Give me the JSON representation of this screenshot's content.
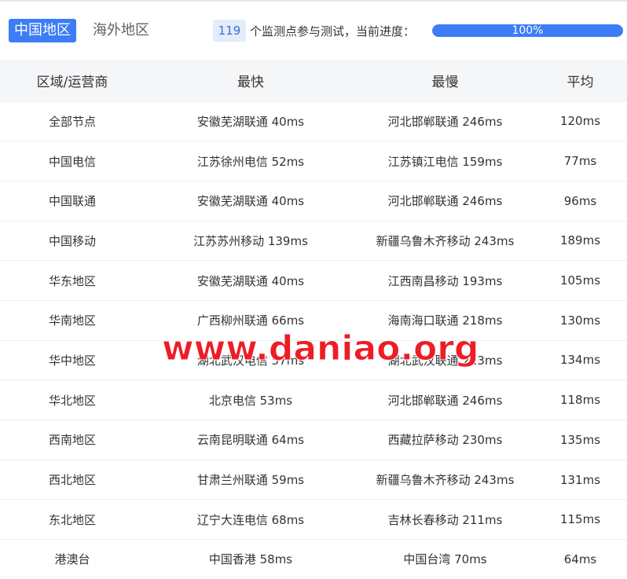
{
  "region_tabs": {
    "domestic": "中国地区",
    "overseas": "海外地区"
  },
  "progress": {
    "node_count": "119",
    "text": "个监测点参与测试，当前进度：",
    "percent_label": "100%",
    "percent": 100
  },
  "table": {
    "headers": [
      "区域/运营商",
      "最快",
      "最慢",
      "平均"
    ],
    "rows": [
      [
        "全部节点",
        "安徽芜湖联通 40ms",
        "河北邯郸联通 246ms",
        "120ms"
      ],
      [
        "中国电信",
        "江苏徐州电信 52ms",
        "江苏镇江电信 159ms",
        "77ms"
      ],
      [
        "中国联通",
        "安徽芜湖联通 40ms",
        "河北邯郸联通 246ms",
        "96ms"
      ],
      [
        "中国移动",
        "江苏苏州移动 139ms",
        "新疆乌鲁木齐移动 243ms",
        "189ms"
      ],
      [
        "华东地区",
        "安徽芜湖联通 40ms",
        "江西南昌移动 193ms",
        "105ms"
      ],
      [
        "华南地区",
        "广西柳州联通 66ms",
        "海南海口联通 218ms",
        "130ms"
      ],
      [
        "华中地区",
        "湖北武汉电信 57ms",
        "湖北武汉联通 213ms",
        "134ms"
      ],
      [
        "华北地区",
        "北京电信 53ms",
        "河北邯郸联通 246ms",
        "118ms"
      ],
      [
        "西南地区",
        "云南昆明联通 64ms",
        "西藏拉萨移动 230ms",
        "135ms"
      ],
      [
        "西北地区",
        "甘肃兰州联通 59ms",
        "新疆乌鲁木齐移动 243ms",
        "131ms"
      ],
      [
        "东北地区",
        "辽宁大连电信 68ms",
        "吉林长春移动 211ms",
        "115ms"
      ],
      [
        "港澳台",
        "中国香港 58ms",
        "中国台湾 70ms",
        "64ms"
      ]
    ]
  },
  "watermark": "www.daniao.org",
  "colors": {
    "accent": "#3c7cf6",
    "header_bg": "#f5f6f8",
    "watermark": "#ee1c25"
  }
}
